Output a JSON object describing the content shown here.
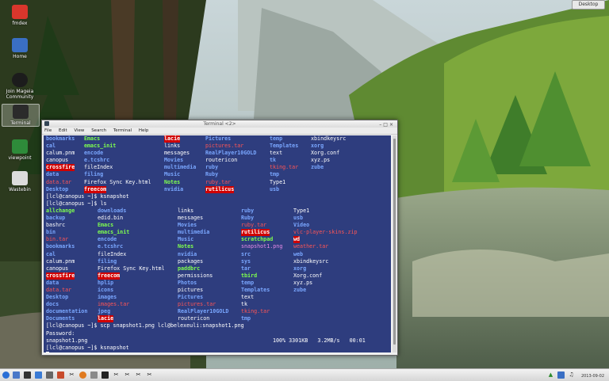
{
  "desktop": {
    "show_desktop_label": "Desktop",
    "icons": [
      {
        "label": "fmdex",
        "icon": "mageia-icon",
        "color": "#d9362c"
      },
      {
        "label": "Home",
        "icon": "home-folder-icon",
        "color": "#3a6fc4"
      },
      {
        "label": "Join Mageia Community",
        "icon": "community-icon",
        "color": "#1c1c1c"
      },
      {
        "label": "Terminal",
        "icon": "terminal-icon",
        "color": "#2b2b2b"
      },
      {
        "label": "viewpoint",
        "icon": "viewpoint-icon",
        "color": "#2e8b3a"
      },
      {
        "label": "Wastebin",
        "icon": "trash-icon",
        "color": "#dcdcdc"
      }
    ]
  },
  "window": {
    "title": "Terminal <2>",
    "menu": [
      "File",
      "Edit",
      "View",
      "Search",
      "Terminal",
      "Help"
    ]
  },
  "terminal": {
    "ls1": [
      [
        [
          "bookmarks",
          "dir"
        ],
        [
          "Emacs",
          "exe"
        ],
        [
          "lacie",
          "hl"
        ],
        [
          "Pictures",
          "dir"
        ],
        [
          "temp",
          "dir"
        ],
        [
          "xbindkeysrc",
          "plain"
        ]
      ],
      [
        [
          "cal",
          "dir"
        ],
        [
          "emacs_init",
          "exe"
        ],
        [
          "links",
          "plain"
        ],
        [
          "pictures.tar",
          "arc"
        ],
        [
          "Templates",
          "dir"
        ],
        [
          "xorg",
          "dir"
        ]
      ],
      [
        [
          "calum.pnm",
          "plain"
        ],
        [
          "encode",
          "dir"
        ],
        [
          "messages",
          "plain"
        ],
        [
          "RealPlayer10GOLD",
          "dir"
        ],
        [
          "text",
          "plain"
        ],
        [
          "Xorg.conf",
          "plain"
        ]
      ],
      [
        [
          "canopus",
          "plain"
        ],
        [
          "e.tcshrc",
          "dir"
        ],
        [
          "Movies",
          "dir"
        ],
        [
          "routericon",
          "plain"
        ],
        [
          "tk",
          "dir"
        ],
        [
          "xyz.ps",
          "plain"
        ]
      ],
      [
        [
          "crossfire",
          "hl"
        ],
        [
          "fileIndex",
          "plain"
        ],
        [
          "multimedia",
          "dir"
        ],
        [
          "ruby",
          "dir"
        ],
        [
          "tking.tar",
          "arc"
        ],
        [
          "zube",
          "dir"
        ]
      ],
      [
        [
          "data",
          "dir"
        ],
        [
          "filing",
          "dir"
        ],
        [
          "Music",
          "dir"
        ],
        [
          "Ruby",
          "dir"
        ],
        [
          "tmp",
          "dir"
        ],
        [
          "",
          ""
        ]
      ],
      [
        [
          "data.tar",
          "arc"
        ],
        [
          "Firefox Sync Key.html",
          "plain"
        ],
        [
          "Notes",
          "exe"
        ],
        [
          "ruby.tar",
          "arc"
        ],
        [
          "Type1",
          "plain"
        ],
        [
          "",
          ""
        ]
      ],
      [
        [
          "Desktop",
          "dir"
        ],
        [
          "freecom",
          "hl"
        ],
        [
          "nvidia",
          "dir"
        ],
        [
          "rutilicus",
          "hl"
        ],
        [
          "usb",
          "dir"
        ],
        [
          "",
          ""
        ]
      ]
    ],
    "prompt1": "[lcl@canopus ~]$ ksnapshot",
    "prompt2": "[lcl@canopus ~]$ ls",
    "ls2": [
      [
        [
          "allchange",
          "exe"
        ],
        [
          "downloads",
          "dir"
        ],
        [
          "links",
          "plain"
        ],
        [
          "ruby",
          "dir"
        ],
        [
          "Type1",
          "plain"
        ]
      ],
      [
        [
          "backup",
          "dir"
        ],
        [
          "edid.bin",
          "plain"
        ],
        [
          "messages",
          "plain"
        ],
        [
          "Ruby",
          "dir"
        ],
        [
          "usb",
          "dir"
        ]
      ],
      [
        [
          "bashrc",
          "plain"
        ],
        [
          "Emacs",
          "exe"
        ],
        [
          "Movies",
          "dir"
        ],
        [
          "ruby.tar",
          "arc"
        ],
        [
          "Video",
          "dir"
        ]
      ],
      [
        [
          "bin",
          "dir"
        ],
        [
          "emacs_init",
          "exe"
        ],
        [
          "multimedia",
          "dir"
        ],
        [
          "rutilicus",
          "hl"
        ],
        [
          "vlc-player-skins.zip",
          "arc"
        ]
      ],
      [
        [
          "bin.tar",
          "arc"
        ],
        [
          "encode",
          "dir"
        ],
        [
          "Music",
          "dir"
        ],
        [
          "scratchpad",
          "exe"
        ],
        [
          "wd",
          "hl"
        ]
      ],
      [
        [
          "bookmarks",
          "dir"
        ],
        [
          "e.tcshrc",
          "dir"
        ],
        [
          "Notes",
          "exe"
        ],
        [
          "snapshot1.png",
          "img"
        ],
        [
          "weather.tar",
          "arc"
        ]
      ],
      [
        [
          "cal",
          "dir"
        ],
        [
          "fileIndex",
          "plain"
        ],
        [
          "nvidia",
          "dir"
        ],
        [
          "src",
          "dir"
        ],
        [
          "web",
          "dir"
        ]
      ],
      [
        [
          "calum.pnm",
          "plain"
        ],
        [
          "filing",
          "dir"
        ],
        [
          "packages",
          "plain"
        ],
        [
          "sys",
          "dir"
        ],
        [
          "xbindkeysrc",
          "plain"
        ]
      ],
      [
        [
          "canopus",
          "plain"
        ],
        [
          "Firefox Sync Key.html",
          "plain"
        ],
        [
          "paddbrc",
          "exe"
        ],
        [
          "tar",
          "dir"
        ],
        [
          "xorg",
          "dir"
        ]
      ],
      [
        [
          "crossfire",
          "hl"
        ],
        [
          "freecom",
          "hl"
        ],
        [
          "permissions",
          "plain"
        ],
        [
          "tbird",
          "exe"
        ],
        [
          "Xorg.conf",
          "plain"
        ]
      ],
      [
        [
          "data",
          "dir"
        ],
        [
          "hplip",
          "dir"
        ],
        [
          "Photos",
          "dir"
        ],
        [
          "temp",
          "dir"
        ],
        [
          "xyz.ps",
          "plain"
        ]
      ],
      [
        [
          "data.tar",
          "arc"
        ],
        [
          "icons",
          "dir"
        ],
        [
          "pictures",
          "plain"
        ],
        [
          "Templates",
          "dir"
        ],
        [
          "zube",
          "dir"
        ]
      ],
      [
        [
          "Desktop",
          "dir"
        ],
        [
          "images",
          "dir"
        ],
        [
          "Pictures",
          "dir"
        ],
        [
          "text",
          "plain"
        ],
        [
          "",
          ""
        ]
      ],
      [
        [
          "docs",
          "dir"
        ],
        [
          "images.tar",
          "arc"
        ],
        [
          "pictures.tar",
          "arc"
        ],
        [
          "tk",
          "plain"
        ],
        [
          "",
          ""
        ]
      ],
      [
        [
          "documentation",
          "dir"
        ],
        [
          "jpeg",
          "dir"
        ],
        [
          "RealPlayer10GOLD",
          "dir"
        ],
        [
          "tking.tar",
          "arc"
        ],
        [
          "",
          ""
        ]
      ],
      [
        [
          "Documents",
          "dir"
        ],
        [
          "lacie",
          "hl"
        ],
        [
          "routericon",
          "plain"
        ],
        [
          "tmp",
          "dir"
        ],
        [
          "",
          ""
        ]
      ]
    ],
    "prompt3": "[lcl@canopus ~]$ scp snapshot1.png lcl@belexeuli:snapshot1.png",
    "password_line": "Password:",
    "transfer_file": "snapshot1.png",
    "transfer_stats": "100% 3301KB   3.2MB/s   00:01",
    "prompt4": "[lcl@canopus ~]$ ksnapshot",
    "cursor_prompt": ""
  },
  "taskbar": {
    "tray_time": "2013-09-02"
  }
}
